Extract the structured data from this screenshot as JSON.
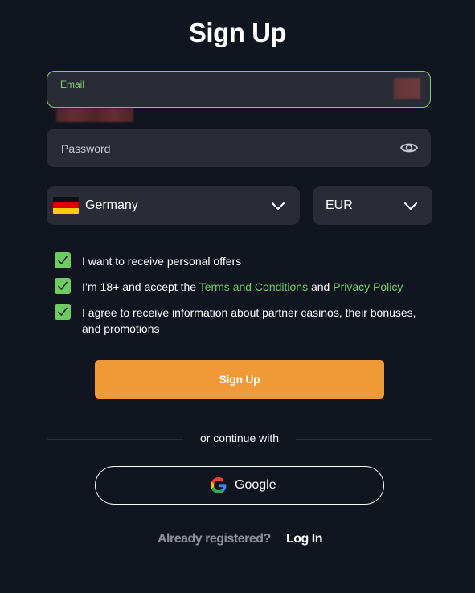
{
  "form": {
    "title": "Sign Up"
  },
  "email": {
    "label": "Email",
    "value": ""
  },
  "password": {
    "placeholder": "Password",
    "toggle_icon": "eye-icon"
  },
  "country": {
    "selected": "Germany",
    "flag_icon": "germany-flag-icon"
  },
  "currency": {
    "selected": "EUR"
  },
  "consents": {
    "offers": {
      "checked": true,
      "label": "I want to receive personal offers"
    },
    "age_terms": {
      "checked": true,
      "prefix": "I’m 18+ and accept the",
      "terms_link": "Terms and Conditions",
      "and_text": "and",
      "privacy_link": "Privacy Policy"
    },
    "partners": {
      "checked": true,
      "label": "I agree to receive information about partner casinos, their bonuses, and promotions"
    }
  },
  "actions": {
    "signup_label": "Sign Up",
    "divider_text": "or continue with",
    "google_label": "Google"
  },
  "footer": {
    "already_registered": "Already registered?",
    "login_label": "Log In"
  },
  "colors": {
    "background": "#111520",
    "field_bg": "#292c36",
    "accent_green": "#6ecb63",
    "signup_orange": "#ef9a37"
  }
}
